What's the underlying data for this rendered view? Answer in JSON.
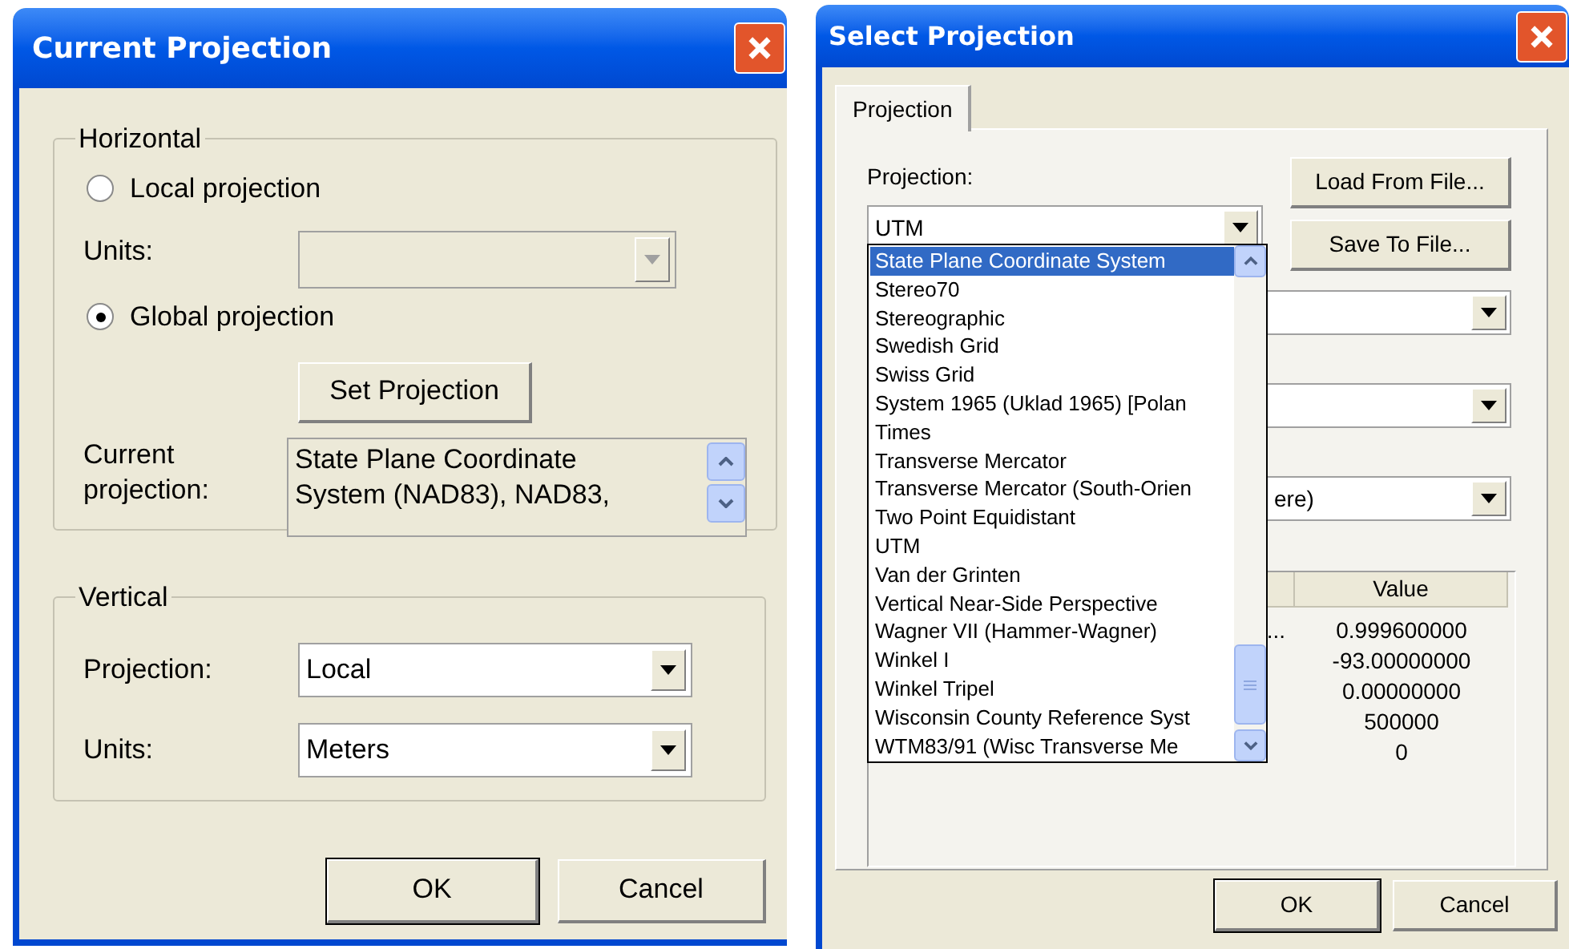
{
  "current_projection_dialog": {
    "title": "Current Projection",
    "horizontal": {
      "legend": "Horizontal",
      "options": [
        {
          "label": "Local projection",
          "selected": false
        },
        {
          "label": "Global projection",
          "selected": true
        }
      ],
      "units": {
        "label": "Units:",
        "disabled": true
      },
      "set_button": "Set Projection",
      "current": {
        "label": "Current projection:",
        "value": "State Plane Coordinate System (NAD83), NAD83,"
      }
    },
    "vertical": {
      "legend": "Vertical",
      "fields": [
        {
          "label": "Projection:",
          "value": "Local"
        },
        {
          "label": "Units:",
          "value": "Meters"
        }
      ]
    },
    "buttons": [
      {
        "label": "OK",
        "default": true
      },
      {
        "label": "Cancel",
        "default": false
      }
    ]
  },
  "select_projection_dialog": {
    "title": "Select Projection",
    "tabs": [
      {
        "label": "Projection",
        "selected": true
      }
    ],
    "projection": {
      "label": "Projection:",
      "value": "UTM"
    },
    "side_buttons": [
      "Load From File...",
      "Save To File..."
    ],
    "partial_combo_value": "ere)",
    "dropdown": {
      "items": [
        {
          "label": "State Plane Coordinate System",
          "selected": true
        },
        {
          "label": "Stereo70",
          "selected": false
        },
        {
          "label": "Stereographic",
          "selected": false
        },
        {
          "label": "Swedish Grid",
          "selected": false
        },
        {
          "label": "Swiss Grid",
          "selected": false
        },
        {
          "label": "System 1965 (Uklad 1965) [Polan",
          "selected": false
        },
        {
          "label": "Times",
          "selected": false
        },
        {
          "label": "Transverse Mercator",
          "selected": false
        },
        {
          "label": "Transverse Mercator (South-Orien",
          "selected": false
        },
        {
          "label": "Two Point Equidistant",
          "selected": false
        },
        {
          "label": "UTM",
          "selected": false
        },
        {
          "label": "Van der Grinten",
          "selected": false
        },
        {
          "label": "Vertical Near-Side Perspective",
          "selected": false
        },
        {
          "label": "Wagner VII (Hammer-Wagner)",
          "selected": false
        },
        {
          "label": "Winkel I",
          "selected": false
        },
        {
          "label": "Winkel Tripel",
          "selected": false
        },
        {
          "label": "Wisconsin County Reference Syst",
          "selected": false
        },
        {
          "label": "WTM83/91 (Wisc Transverse Me",
          "selected": false
        }
      ]
    },
    "table": {
      "value_header": "Value",
      "rows": [
        {
          "column_1": "...",
          "value": "0.999600000"
        },
        {
          "value": "-93.00000000"
        },
        {
          "value": "0.00000000"
        },
        {
          "value": "500000"
        },
        {
          "value": "0"
        }
      ]
    },
    "buttons": [
      {
        "label": "OK",
        "default": true
      },
      {
        "label": "Cancel",
        "default": false
      }
    ]
  }
}
